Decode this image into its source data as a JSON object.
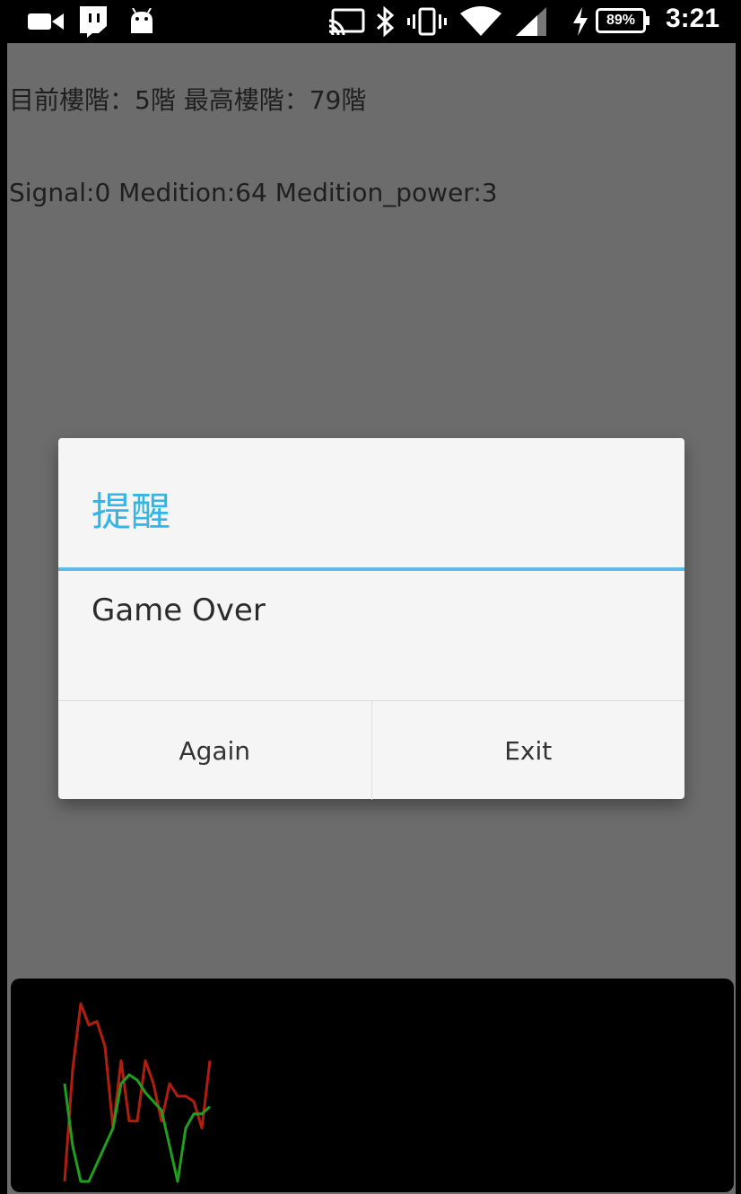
{
  "status_bar": {
    "time": "3:21",
    "battery": "89%",
    "icons": [
      "video-camera-icon",
      "twitch-icon",
      "android-icon",
      "cast-icon",
      "bluetooth-icon",
      "vibrate-icon",
      "wifi-icon",
      "signal-icon",
      "charging-icon"
    ]
  },
  "app": {
    "floor_line": "目前樓階：5階  最高樓階：79階",
    "signal_line": "Signal:0 Medition:64  Medition_power:3"
  },
  "dialog": {
    "title": "提醒",
    "message": "Game Over",
    "buttons": {
      "again": "Again",
      "exit": "Exit"
    },
    "accent_color": "#33b5e5"
  },
  "graph": {
    "series": [
      {
        "color": "#b01e10",
        "values": [
          0,
          63,
          100,
          88,
          90,
          76,
          30,
          68,
          34,
          34,
          68,
          55,
          34,
          55,
          48,
          48,
          45,
          30,
          68
        ]
      },
      {
        "color": "#1f9e1f",
        "values": [
          55,
          20,
          0,
          0,
          10,
          20,
          30,
          55,
          60,
          57,
          50,
          45,
          40,
          20,
          0,
          30,
          38,
          38,
          42
        ]
      }
    ]
  }
}
